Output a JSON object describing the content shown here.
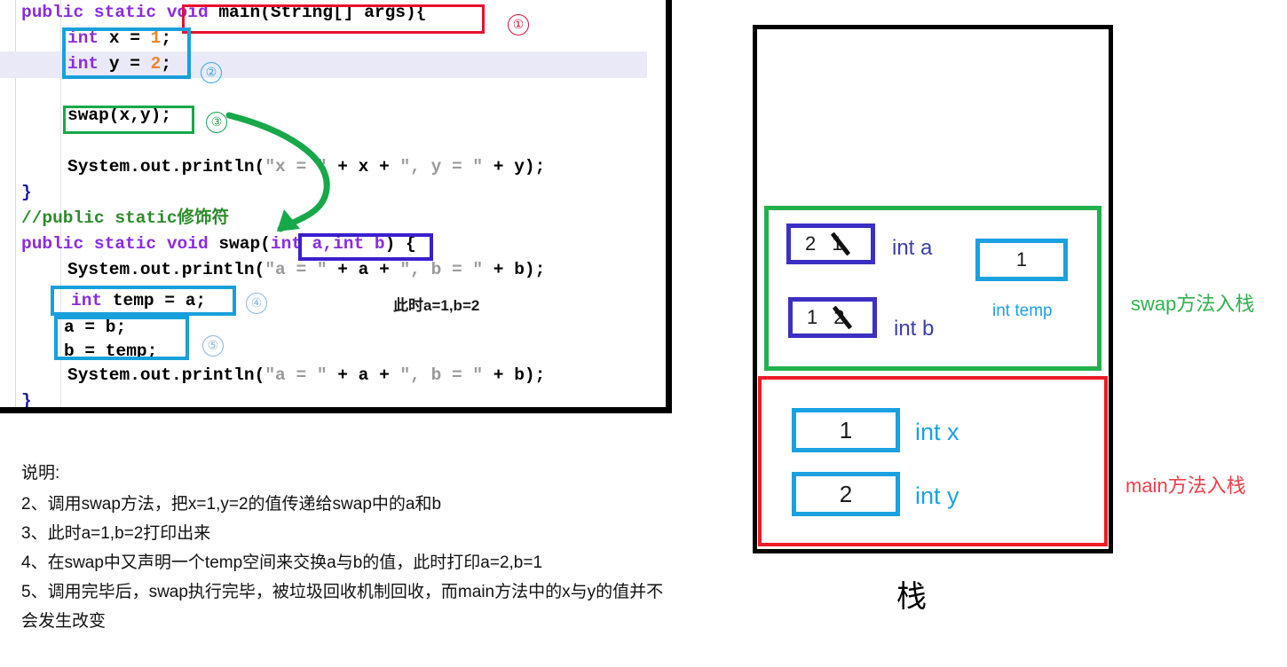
{
  "code": {
    "lines": [
      {
        "id": "l1",
        "text": "public static void main(String[] args){"
      },
      {
        "id": "l2",
        "text": "    int x = 1;"
      },
      {
        "id": "l3",
        "text": "    int y = 2;"
      },
      {
        "id": "l4",
        "text": ""
      },
      {
        "id": "l5",
        "text": "    swap(x,y);"
      },
      {
        "id": "l6",
        "text": ""
      },
      {
        "id": "l7",
        "text": "    System.out.println(\"x = \" + x + \", y = \" + y);"
      },
      {
        "id": "l8",
        "text": "}"
      },
      {
        "id": "l9",
        "text": "//public static修饰符"
      },
      {
        "id": "l10",
        "text": "public static void swap(int a,int b) {"
      },
      {
        "id": "l11",
        "text": "    System.out.println(\"a = \" + a + \", b = \" + b);"
      },
      {
        "id": "l12",
        "text": "    int temp = a;"
      },
      {
        "id": "l13",
        "text": "    a = b;"
      },
      {
        "id": "l14",
        "text": "    b = temp;"
      },
      {
        "id": "l15",
        "text": "    System.out.println(\"a = \" + a + \", b = \" + b);"
      },
      {
        "id": "l16",
        "text": "}"
      }
    ],
    "tokens": {
      "public": "public",
      "static": "static",
      "void": "void",
      "main": "main",
      "string_args": "(String[] args){",
      "int": "int",
      "x": "x",
      "y": "y",
      "a": "a",
      "b": "b",
      "temp": "temp",
      "one": "1",
      "two": "2",
      "swap_call": "swap(x,y);",
      "comment": "//public static修饰符",
      "swap_name": "swap",
      "params": "int a,int b"
    },
    "markers": [
      {
        "id": "m1",
        "label": "①",
        "color": "#d2143c"
      },
      {
        "id": "m2",
        "label": "②",
        "color": "#38a8d8"
      },
      {
        "id": "m3",
        "label": "③",
        "color": "#1d9e4e"
      },
      {
        "id": "m4",
        "label": "④",
        "color": "#8ab8d8"
      },
      {
        "id": "m5",
        "label": "⑤",
        "color": "#8ab8d8"
      }
    ],
    "inline_note": "此时a=1,b=2"
  },
  "description": {
    "title": "说明:",
    "items": [
      "2、调用swap方法，把x=1,y=2的值传递给swap中的a和b",
      "3、此时a=1,b=2打印出来",
      "4、在swap中又声明一个temp空间来交换a与b的值，此时打印a=2,b=1",
      "5、调用完毕后，swap执行完毕，被垃圾回收机制回收，而main方法中的x与y的值并不会发生改变"
    ]
  },
  "stack": {
    "caption": "栈",
    "swap_frame": {
      "side_label": "swap方法入栈",
      "side_color": "#2fb24d",
      "border_color": "#22b14c",
      "slots": [
        {
          "name": "int a",
          "value": "2",
          "old_value": "1",
          "struck": true,
          "box_color": "#3b2fc4",
          "label_color": "#3b3fa8"
        },
        {
          "name": "int b",
          "value": "1",
          "old_value": "2",
          "struck": true,
          "box_color": "#3b2fc4",
          "label_color": "#3b3fa8"
        },
        {
          "name": "int temp",
          "value": "1",
          "old_value": "",
          "struck": false,
          "box_color": "#1ba1e2",
          "label_color": "#1ba1e2"
        }
      ]
    },
    "main_frame": {
      "side_label": "main方法入栈",
      "side_color": "#f0404a",
      "border_color": "#ed1c24",
      "slots": [
        {
          "name": "int x",
          "value": "1",
          "box_color": "#1ba1e2",
          "label_color": "#1ba1e2"
        },
        {
          "name": "int y",
          "value": "2",
          "box_color": "#1ba1e2",
          "label_color": "#1ba1e2"
        }
      ]
    }
  }
}
